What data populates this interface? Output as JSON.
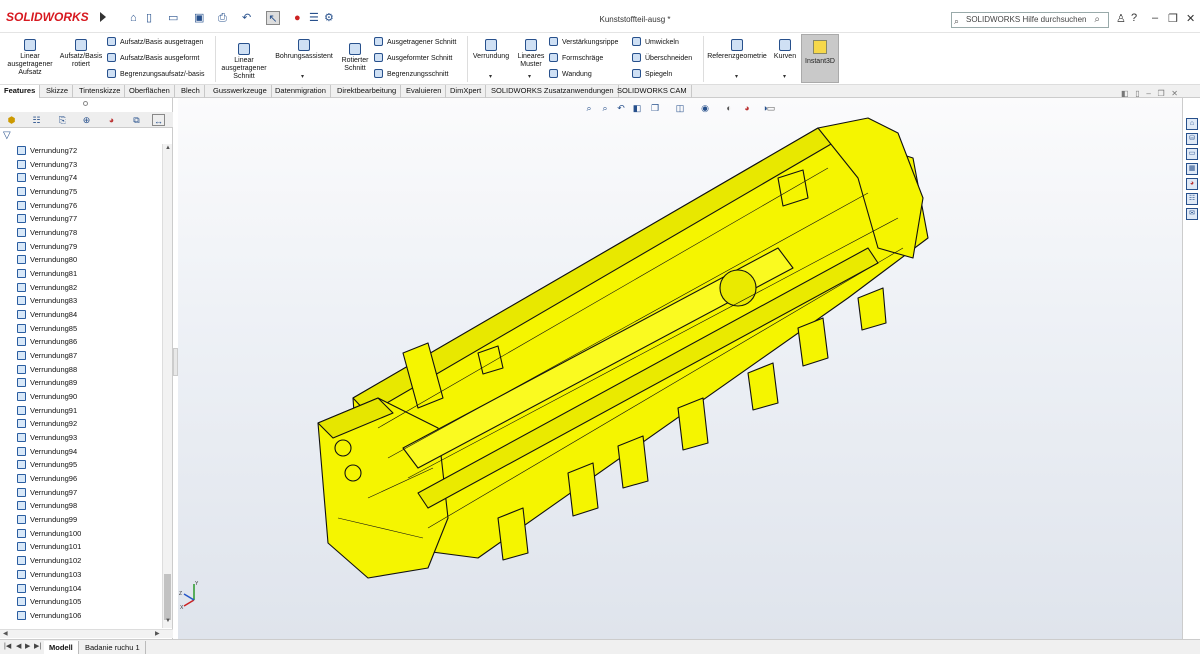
{
  "app": {
    "logo": "SOLIDWORKS",
    "title": "Kunststoffteil-ausg *"
  },
  "search": {
    "placeholder": "SOLIDWORKS Hilfe durchsuchen"
  },
  "colors": {
    "part": "#f5f500",
    "part_edge": "#111111",
    "accent": "#27508c",
    "ribbon_active": "#c9c9c9"
  },
  "ribbon": {
    "linear_aufsatz": "Linear ausgetragener Aufsatz",
    "aufsatz_rotiert": "Aufsatz/Basis rotiert",
    "aufsatz_ausgetragen": "Aufsatz/Basis ausgetragen",
    "aufsatz_ausgeformt": "Aufsatz/Basis ausgeformt",
    "begrenzung_aufsatz": "Begrenzungsaufsatz/-basis",
    "linear_schnitt": "Linear ausgetragener Schnitt",
    "bohrungsassistent": "Bohrungsassistent",
    "rotierter_schnitt": "Rotierter Schnitt",
    "ausgetragener_schnitt": "Ausgetragener Schnitt",
    "ausgeformter_schnitt": "Ausgeformter Schnitt",
    "begrenzungsschnitt": "Begrenzungsschnitt",
    "verrundung": "Verrundung",
    "lineares_muster": "Lineares Muster",
    "verstaerkungsrippe": "Verstärkungsrippe",
    "formschraege": "Formschräge",
    "wandung": "Wandung",
    "umwickeln": "Umwickeln",
    "ueberschneiden": "Überschneiden",
    "spiegeln": "Spiegeln",
    "referenzgeometrie": "Referenzgeometrie",
    "kurven": "Kurven",
    "instant3d": "Instant3D"
  },
  "tabs": [
    "Features",
    "Skizze",
    "Tintenskizze",
    "Oberflächen",
    "Blech",
    "Gusswerkzeuge",
    "Datenmigration",
    "Direktbearbeitung",
    "Evaluieren",
    "DimXpert",
    "SOLIDWORKS Zusatzanwendungen",
    "SOLIDWORKS CAM"
  ],
  "tree": {
    "items": [
      "Verrundung72",
      "Verrundung73",
      "Verrundung74",
      "Verrundung75",
      "Verrundung76",
      "Verrundung77",
      "Verrundung78",
      "Verrundung79",
      "Verrundung80",
      "Verrundung81",
      "Verrundung82",
      "Verrundung83",
      "Verrundung84",
      "Verrundung85",
      "Verrundung86",
      "Verrundung87",
      "Verrundung88",
      "Verrundung89",
      "Verrundung90",
      "Verrundung91",
      "Verrundung92",
      "Verrundung93",
      "Verrundung94",
      "Verrundung95",
      "Verrundung96",
      "Verrundung97",
      "Verrundung98",
      "Verrundung99",
      "Verrundung100",
      "Verrundung101",
      "Verrundung102",
      "Verrundung103",
      "Verrundung104",
      "Verrundung105",
      "Verrundung106"
    ]
  },
  "status": {
    "tabs": [
      "Modell",
      "Badanie ruchu 1"
    ]
  },
  "triad": {
    "x": "X",
    "y": "Y",
    "z": "Z"
  }
}
